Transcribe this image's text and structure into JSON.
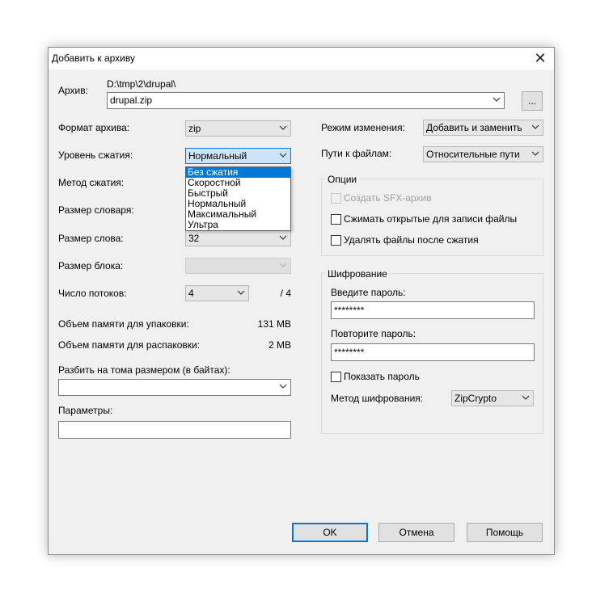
{
  "dialog": {
    "title": "Добавить к архиву"
  },
  "archive": {
    "label": "Архив:",
    "path": "D:\\tmp\\2\\drupal\\",
    "name": "drupal.zip",
    "browse_label": "..."
  },
  "left": {
    "format_label": "Формат архива:",
    "format_value": "zip",
    "level_label": "Уровень сжатия:",
    "level_value": "Нормальный",
    "level_options": [
      "Без сжатия",
      "Скоростной",
      "Быстрый",
      "Нормальный",
      "Максимальный",
      "Ультра"
    ],
    "level_selected_index": 0,
    "method_label": "Метод сжатия:",
    "dict_label": "Размер словаря:",
    "word_label": "Размер слова:",
    "word_value": "32",
    "block_label": "Размер блока:",
    "block_value": "",
    "threads_label": "Число потоков:",
    "threads_value": "4",
    "threads_max": "/ 4",
    "mem_pack_label": "Объем памяти для упаковки:",
    "mem_pack_value": "131 MB",
    "mem_unpack_label": "Объем памяти для распаковки:",
    "mem_unpack_value": "2 MB",
    "split_label": "Разбить на тома размером (в байтах):",
    "split_value": "",
    "params_label": "Параметры:",
    "params_value": ""
  },
  "right": {
    "update_label": "Режим изменения:",
    "update_value": "Добавить и заменить",
    "paths_label": "Пути к файлам:",
    "paths_value": "Относительные пути",
    "options_title": "Опции",
    "opt_sfx": "Создать SFX-архив",
    "opt_shared": "Сжимать открытые для записи файлы",
    "opt_delete": "Удалять файлы после сжатия",
    "enc_title": "Шифрование",
    "pwd_label": "Введите пароль:",
    "pwd_value": "********",
    "pwd2_label": "Повторите пароль:",
    "pwd2_value": "********",
    "show_pwd": "Показать пароль",
    "enc_method_label": "Метод шифрования:",
    "enc_method_value": "ZipCrypto"
  },
  "buttons": {
    "ok": "OK",
    "cancel": "Отмена",
    "help": "Помощь"
  },
  "icons": {
    "close": "close-icon",
    "chevron": "chevron-down-icon"
  }
}
